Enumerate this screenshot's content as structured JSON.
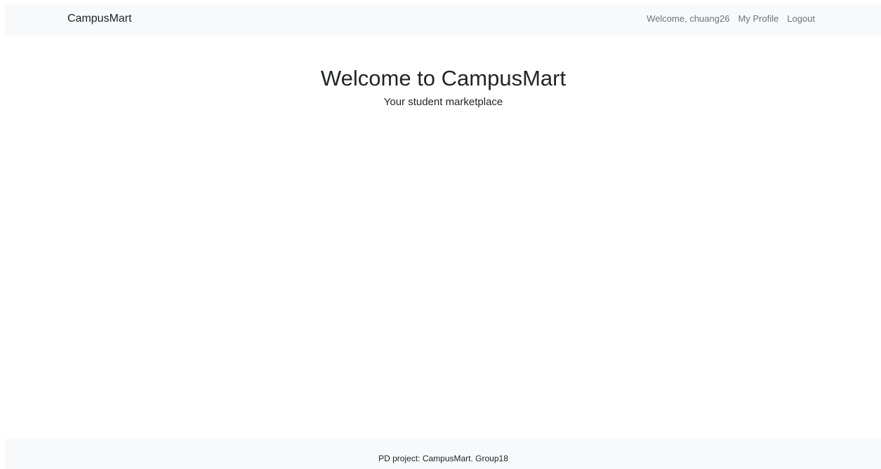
{
  "navbar": {
    "brand": "CampusMart",
    "welcome_text": "Welcome, chuang26",
    "profile_link": "My Profile",
    "logout_link": "Logout"
  },
  "hero": {
    "title": "Welcome to CampusMart",
    "subtitle": "Your student marketplace"
  },
  "footer": {
    "text": "PD project: CampusMart. Group18"
  },
  "colors": {
    "bar_background": "#f8f9fa",
    "text_primary": "#212529",
    "text_muted": "#6c757d",
    "page_background": "#ffffff"
  }
}
